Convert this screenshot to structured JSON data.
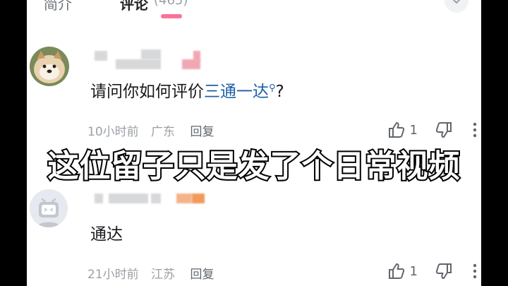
{
  "tabs": {
    "intro_label": "简介",
    "comments_label": "评论",
    "comments_count": "(465)"
  },
  "comments": [
    {
      "content_prefix": "请问你如何评价",
      "hashtag": "三通一达",
      "content_suffix": "?",
      "time": "10小时前",
      "location": "广东",
      "reply_label": "回复",
      "likes": "1"
    },
    {
      "content": "通达",
      "time": "21小时前",
      "location": "江苏",
      "reply_label": "回复",
      "likes": "1"
    }
  ],
  "overlay": {
    "caption": "这位留子只是发了个日常视频"
  },
  "colors": {
    "accent": "#fb7299",
    "link": "#1d5fa8",
    "meta": "#9aa0a6"
  }
}
